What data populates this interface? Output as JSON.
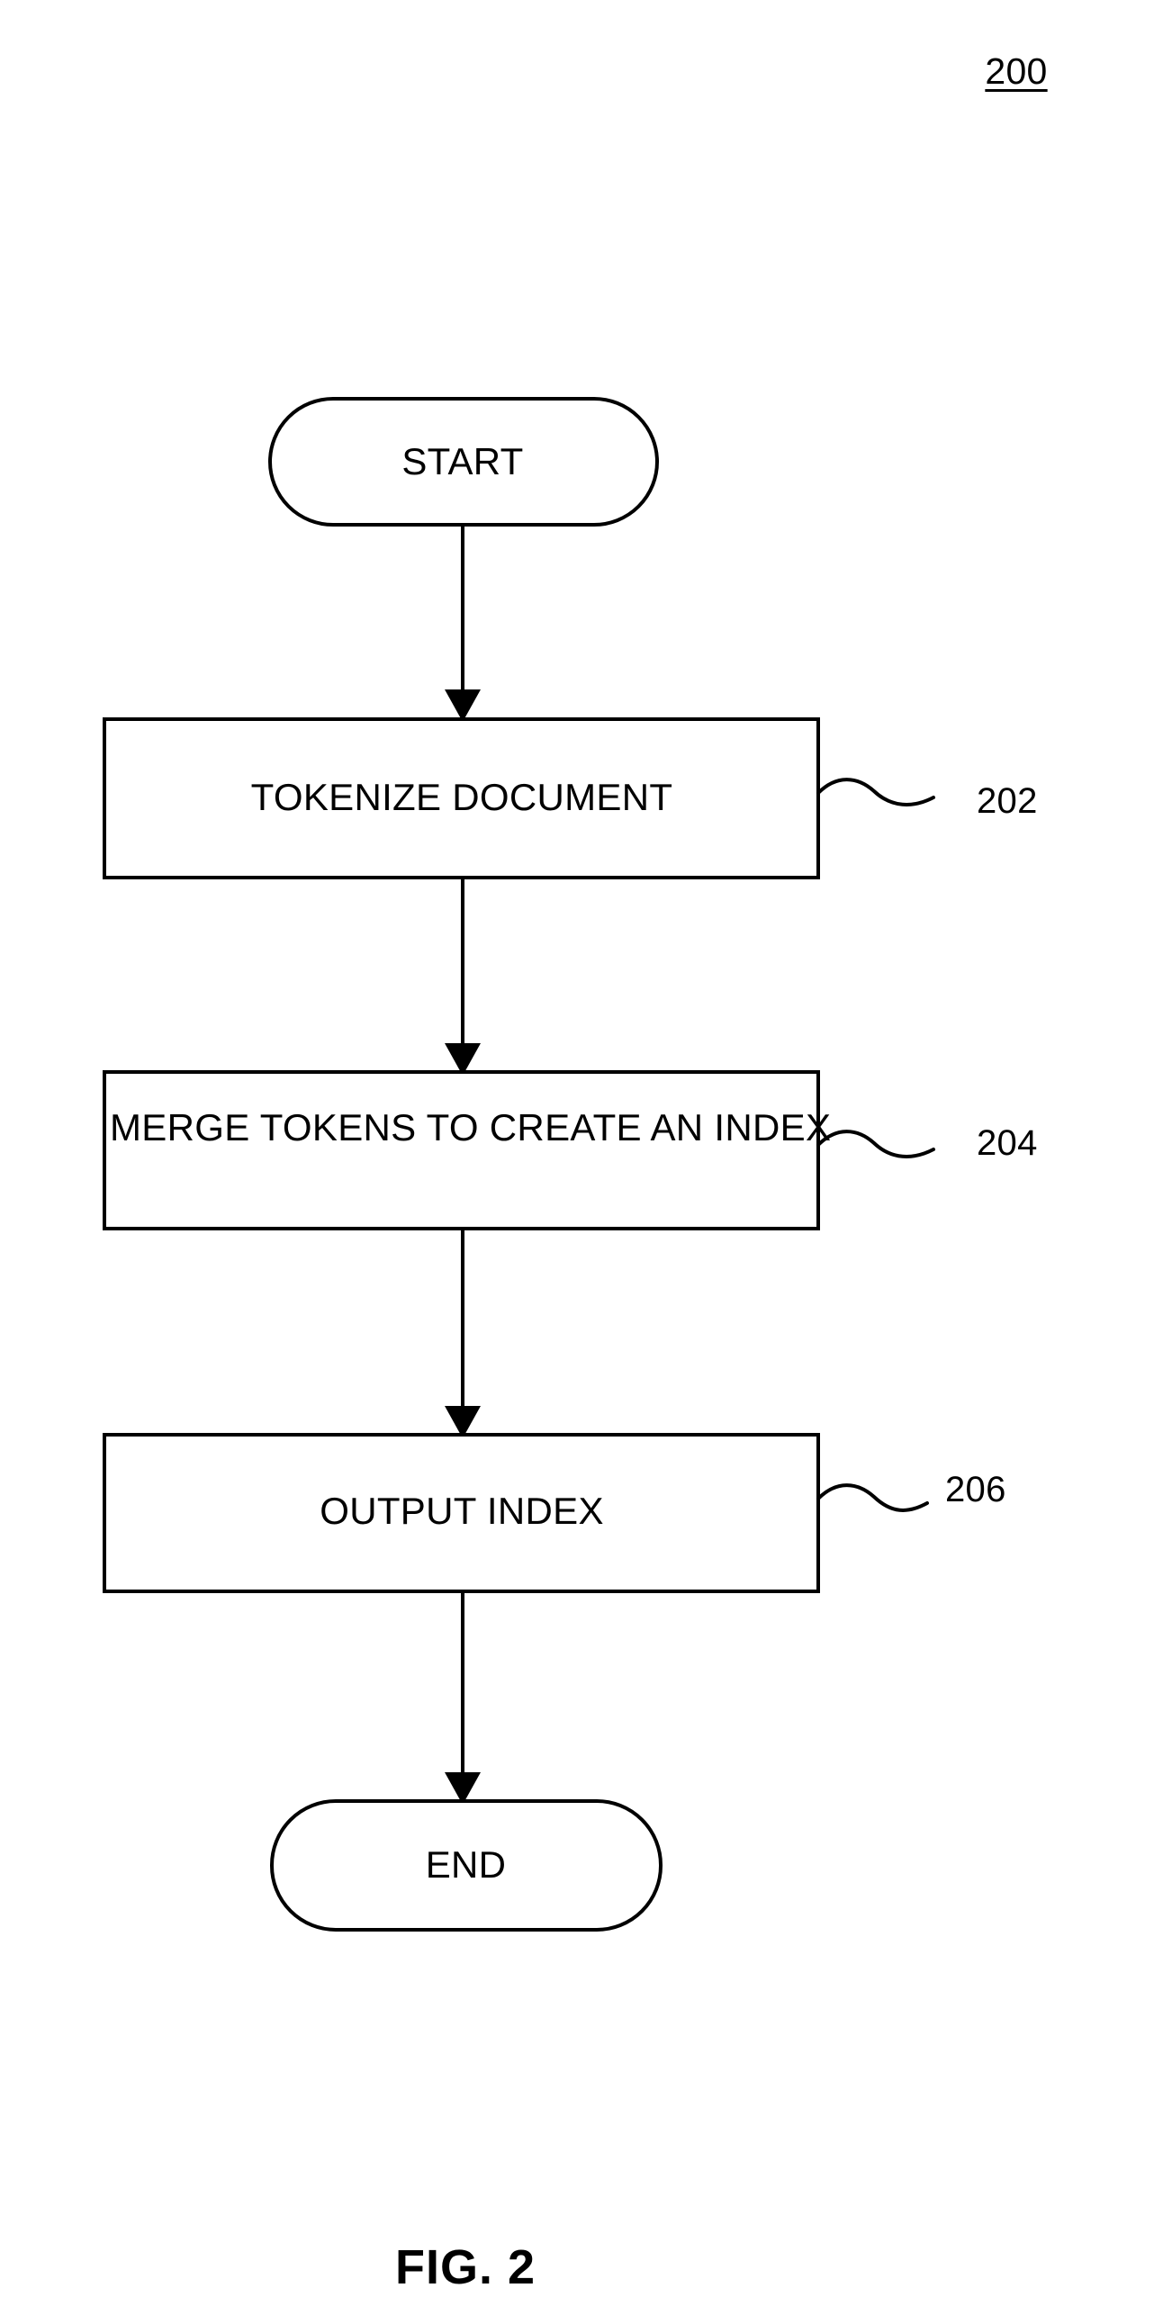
{
  "figure": {
    "reference_numeral": "200",
    "caption": "FIG. 2"
  },
  "nodes": {
    "start": {
      "label": "START",
      "shape": "stadium"
    },
    "step_202": {
      "label": "TOKENIZE DOCUMENT",
      "shape": "rectangle",
      "ref": "202"
    },
    "step_204": {
      "label": "MERGE TOKENS TO CREATE AN INDEX",
      "shape": "rectangle",
      "ref": "204"
    },
    "step_206": {
      "label": "OUTPUT INDEX",
      "shape": "rectangle",
      "ref": "206"
    },
    "end": {
      "label": "END",
      "shape": "stadium"
    }
  },
  "colors": {
    "stroke": "#000000",
    "background": "#ffffff"
  }
}
